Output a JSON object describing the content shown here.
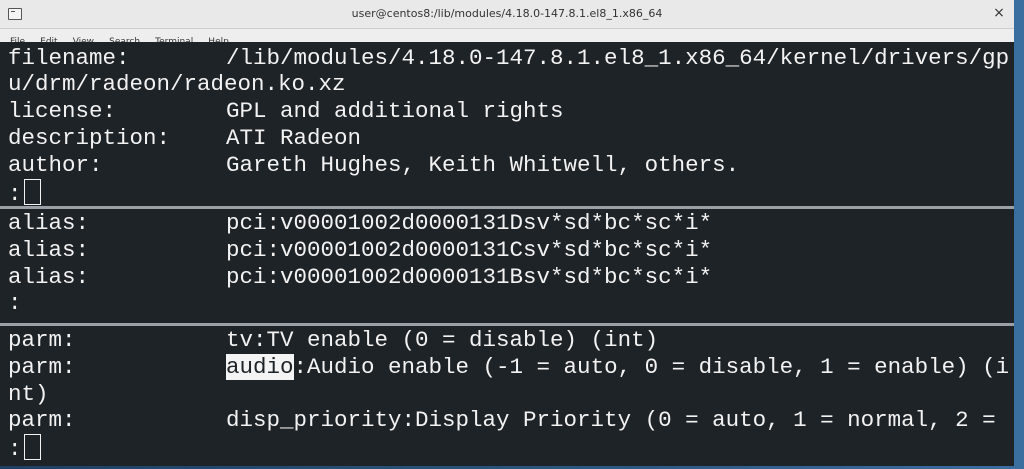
{
  "window": {
    "title": "user@centos8:/lib/modules/4.18.0-147.8.1.el8_1.x86_64",
    "close_glyph": "×"
  },
  "menu": [
    "File",
    "Edit",
    "View",
    "Search",
    "Terminal",
    "Help"
  ],
  "pane1": {
    "lines": [
      {
        "key": "filename:",
        "value": "/lib/modules/4.18.0-147.8.1.el8_1.x86_64/kernel/drivers/gp"
      },
      {
        "key": "",
        "value": "u/drm/radeon/radeon.ko.xz"
      },
      {
        "key": "license:",
        "value": "GPL and additional rights"
      },
      {
        "key": "description:",
        "value": "ATI Radeon"
      },
      {
        "key": "author:",
        "value": "Gareth Hughes, Keith Whitwell, others."
      }
    ],
    "prompt": ":"
  },
  "pane2": {
    "lines": [
      {
        "key": "alias:",
        "value": "pci:v00001002d0000131Dsv*sd*bc*sc*i*"
      },
      {
        "key": "alias:",
        "value": "pci:v00001002d0000131Csv*sd*bc*sc*i*"
      },
      {
        "key": "alias:",
        "value": "pci:v00001002d0000131Bsv*sd*bc*sc*i*"
      }
    ],
    "prompt": ":"
  },
  "pane3": {
    "line1": {
      "key": "parm:",
      "value": "tv:TV enable (0 = disable) (int)"
    },
    "line2": {
      "key": "parm:",
      "highlight": "audio",
      "rest": ":Audio enable (-1 = auto, 0 = disable, 1 = enable) (i"
    },
    "line3": "nt)",
    "line4": {
      "key": "parm:",
      "value": "disp_priority:Display Priority (0 = auto, 1 = normal, 2 ="
    },
    "prompt": ":"
  }
}
